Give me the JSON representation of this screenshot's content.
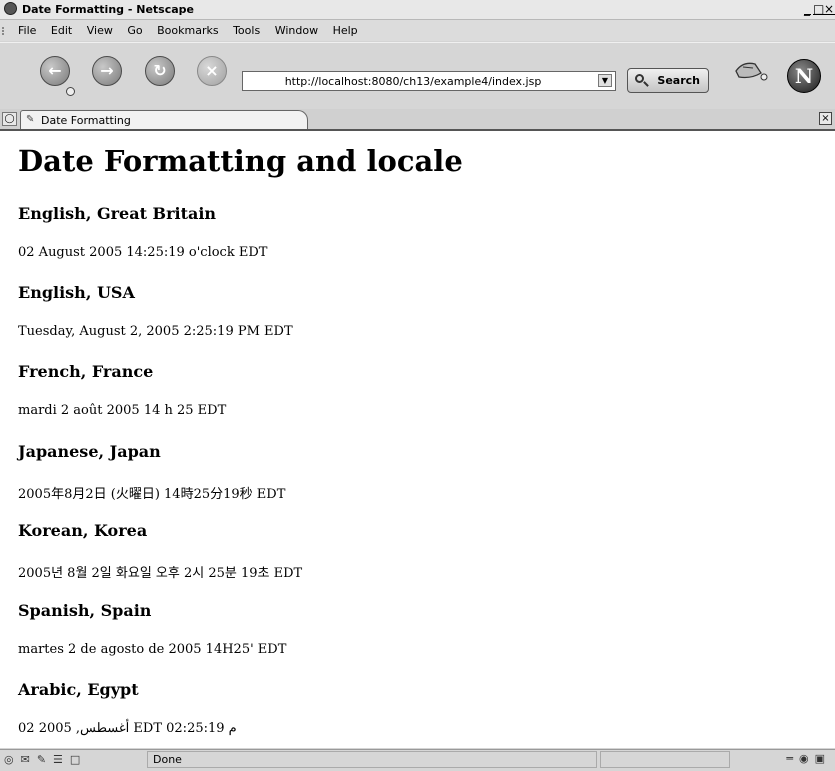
{
  "window": {
    "title": "Date Formatting - Netscape",
    "controls": [
      "_",
      "□",
      "×"
    ]
  },
  "menu": [
    "File",
    "Edit",
    "View",
    "Go",
    "Bookmarks",
    "Tools",
    "Window",
    "Help"
  ],
  "toolbar": {
    "url": "http://localhost:8080/ch13/example4/index.jsp",
    "search_label": "Search",
    "buttons": [
      "back-icon",
      "forward-icon",
      "reload-icon",
      "stop-icon"
    ]
  },
  "tabs": [
    {
      "label": "Date Formatting"
    }
  ],
  "page": {
    "heading": "Date Formatting and locale",
    "entries": [
      {
        "locale": "English, Great Britain",
        "date": "02 August 2005 14:25:19 o'clock EDT"
      },
      {
        "locale": "English, USA",
        "date": "Tuesday, August 2, 2005 2:25:19 PM EDT"
      },
      {
        "locale": "French, France",
        "date": "mardi 2 août 2005 14 h 25 EDT"
      },
      {
        "locale": "Japanese, Japan",
        "date": "2005年8月2日 (火曜日) 14時25分19秒 EDT"
      },
      {
        "locale": "Korean, Korea",
        "date": "2005년 8월 2일 화요일 오후 2시 25분 19초 EDT"
      },
      {
        "locale": "Spanish, Spain",
        "date": "martes 2 de agosto de 2005 14H25' EDT"
      },
      {
        "locale": "Arabic, Egypt",
        "date": "02 أغسطس, 2005 EDT 02:25:19 م"
      }
    ]
  },
  "statusbar": {
    "status": "Done"
  }
}
